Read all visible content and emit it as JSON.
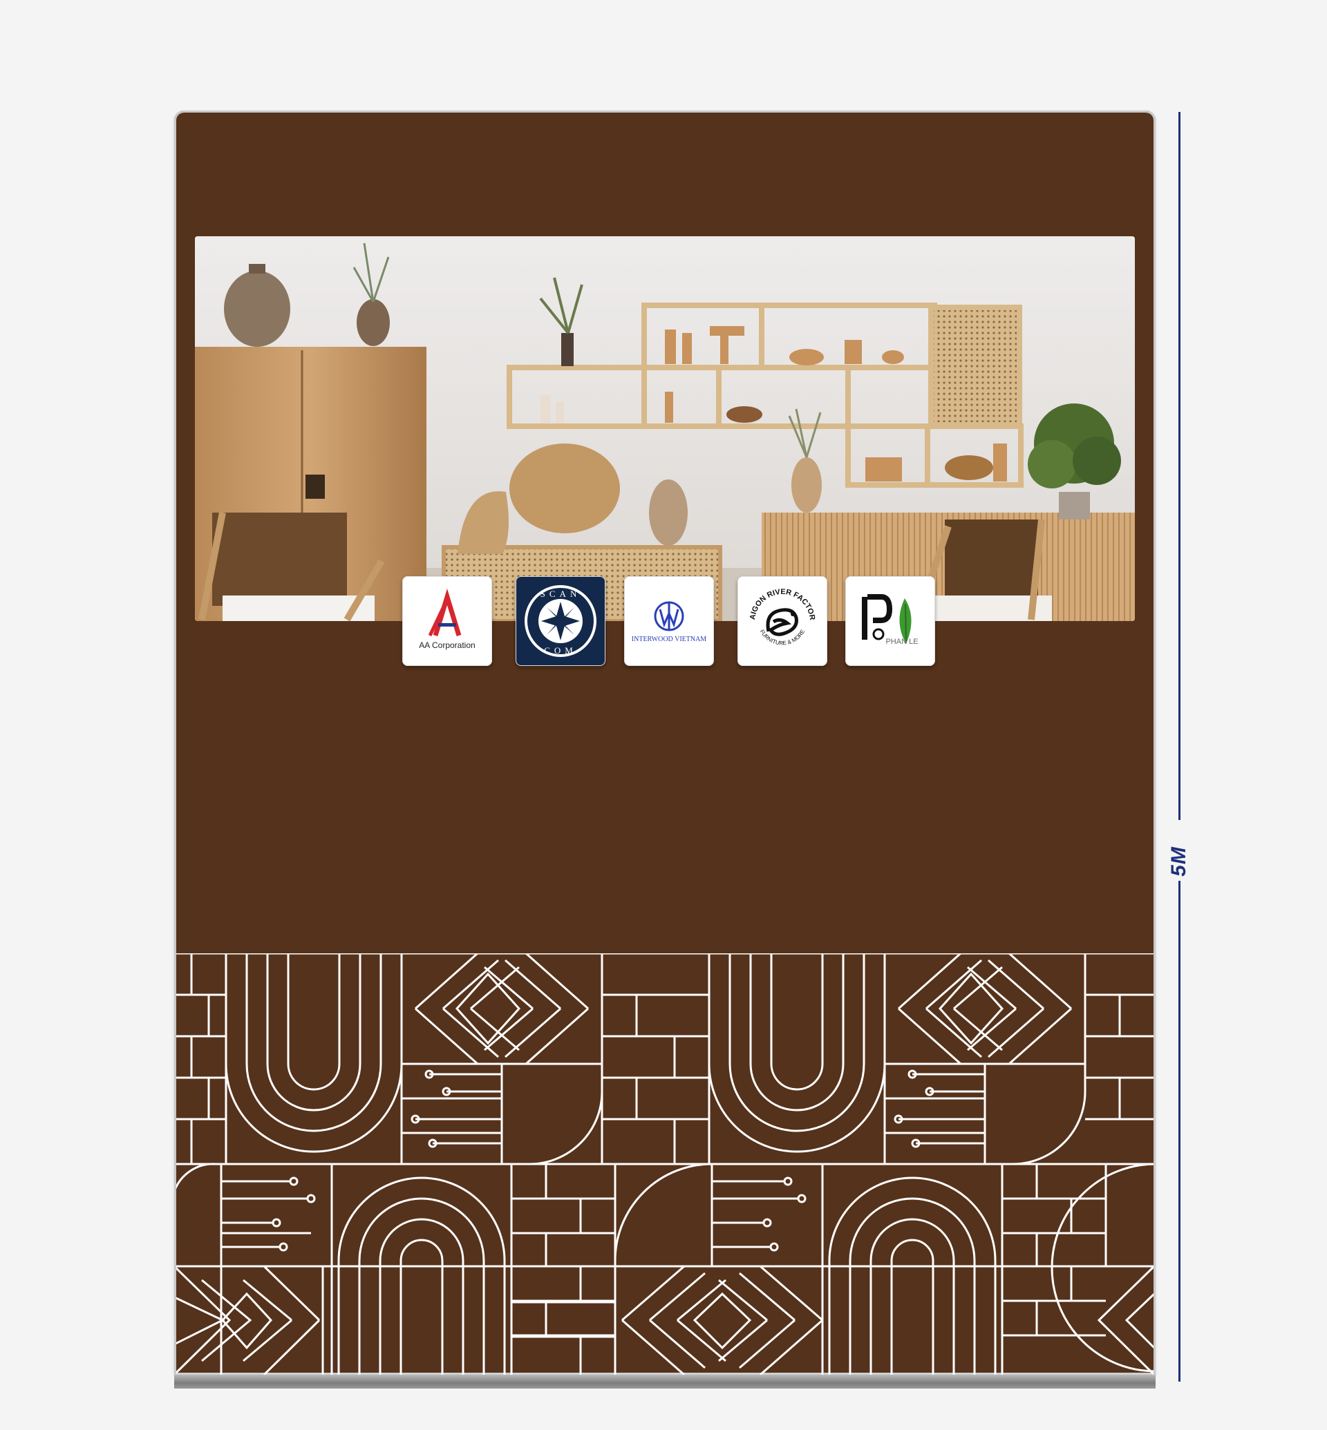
{
  "backdrop": {
    "panel_color": "#55321c",
    "pattern_line_color": "#ffffff",
    "height_label": "5M",
    "measure_color": "#1e2f7a"
  },
  "logos": [
    {
      "name": "AA Corporation",
      "label": "AA Corporation",
      "icon": "aa-logo-icon"
    },
    {
      "name": "Scancom",
      "label_top": "SCAN",
      "label_bottom": "COM",
      "icon": "scancom-star-icon"
    },
    {
      "name": "Interwood Vietnam",
      "label": "INTERWOOD VIETNAM",
      "icon": "interwood-logo-icon"
    },
    {
      "name": "Saigon River Factory",
      "label_top": "SAIGON RIVER FACTORY",
      "label_bottom": "FURNITURE & MORE",
      "icon": "dragon-icon"
    },
    {
      "name": "Phan Le",
      "label": "PHAN LE",
      "icon": "leaf-icon"
    }
  ]
}
